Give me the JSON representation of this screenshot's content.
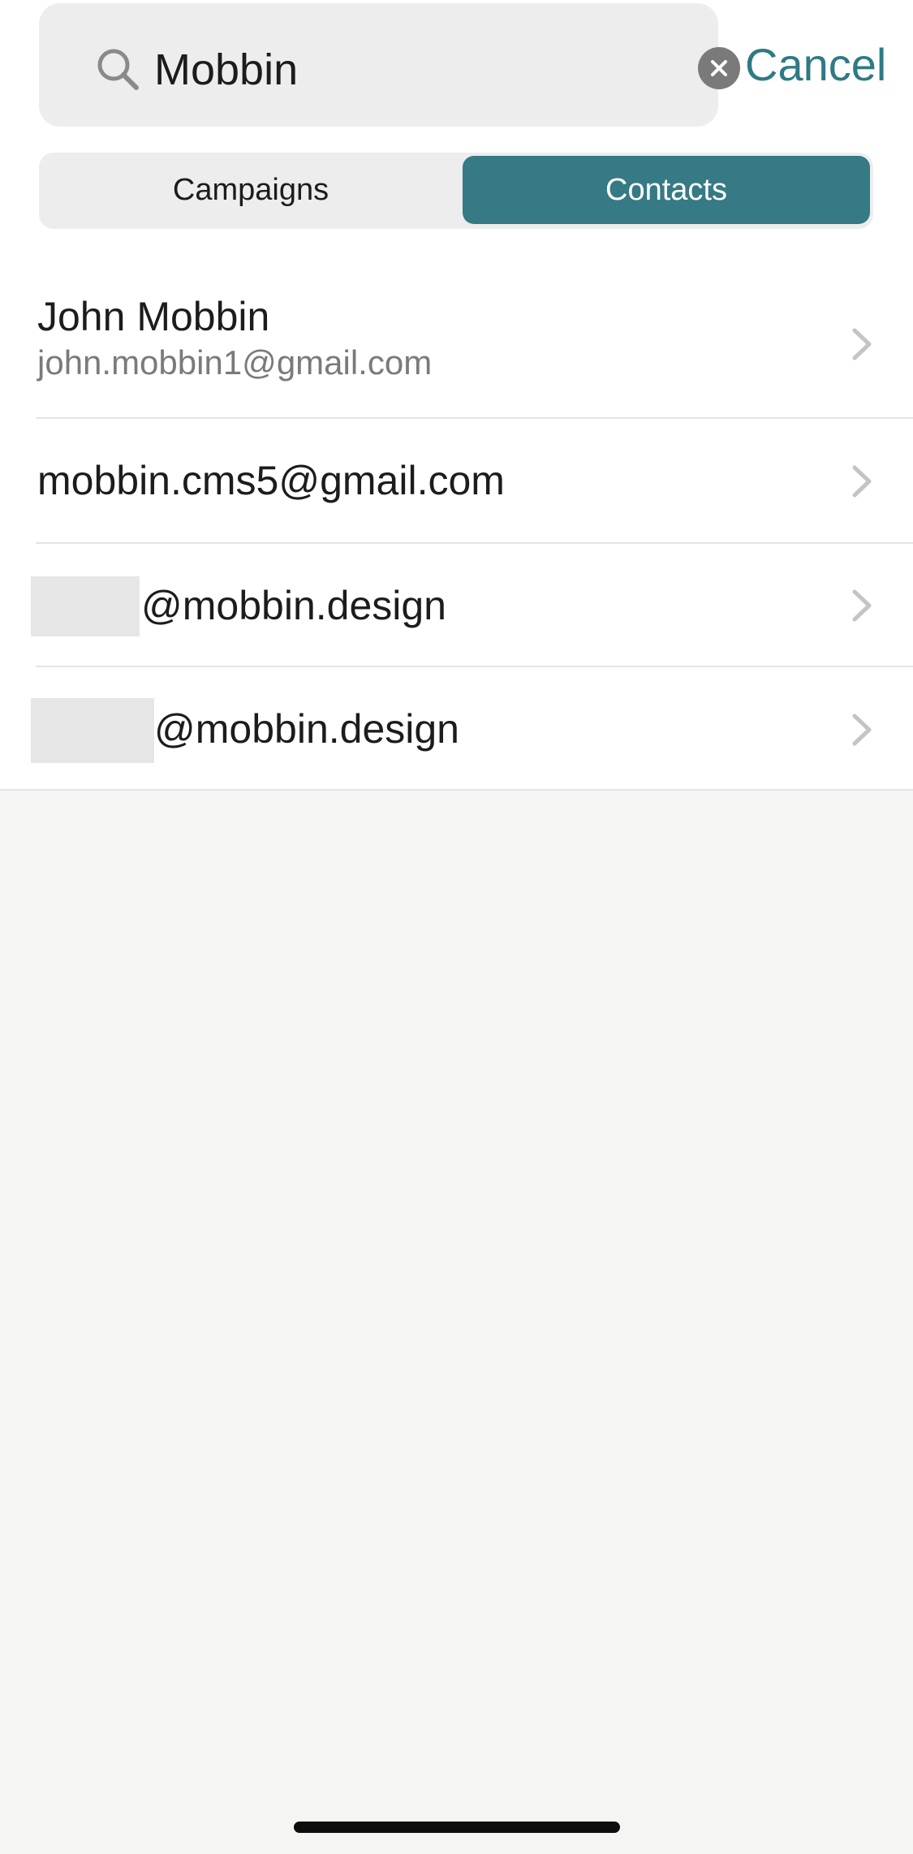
{
  "search": {
    "query": "Mobbin",
    "cancel_label": "Cancel"
  },
  "segments": {
    "campaigns_label": "Campaigns",
    "contacts_label": "Contacts",
    "selected": "Contacts"
  },
  "contacts": [
    {
      "name": "John Mobbin",
      "email": "john.mobbin1@gmail.com"
    },
    {
      "name": "mobbin.cms5@gmail.com"
    },
    {
      "name_suffix": "@mobbin.design",
      "redacted": true
    },
    {
      "name_suffix": "@mobbin.design",
      "redacted": true
    }
  ],
  "colors": {
    "accent": "#357a84",
    "cancel_text": "#2f7a84",
    "background": "#f5f5f4"
  },
  "icons": {
    "search": "search-icon",
    "clear": "clear-icon",
    "chevron": "chevron-right-icon"
  }
}
